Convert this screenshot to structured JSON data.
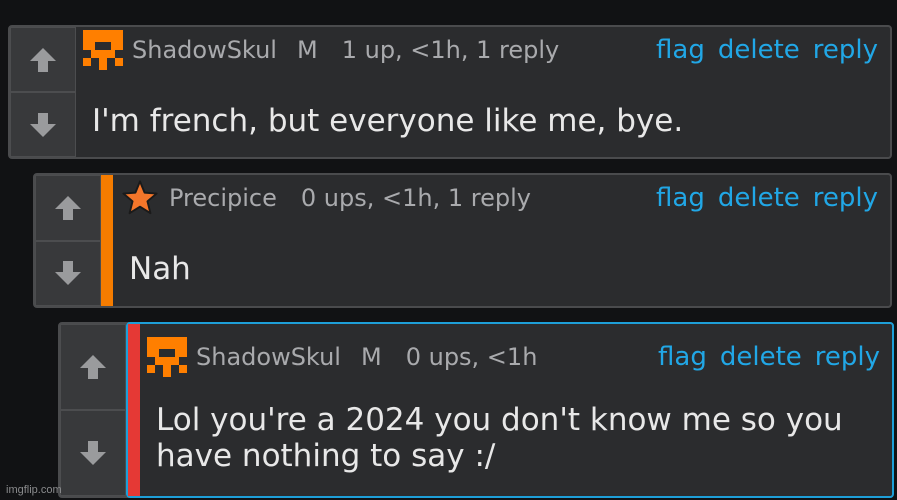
{
  "comments": [
    {
      "username": "ShadowSkul",
      "badge": "M",
      "meta": "1 up, <1h, 1 reply",
      "actions": {
        "flag": "flag",
        "delete": "delete",
        "reply": "reply"
      },
      "text": "I'm french, but everyone like me, bye.",
      "avatar": "orange-pixel-skull-avatar",
      "stripe_color": ""
    },
    {
      "username": "Precipice",
      "badge": "",
      "meta": "0 ups, <1h, 1 reply",
      "actions": {
        "flag": "flag",
        "delete": "delete",
        "reply": "reply"
      },
      "text": "Nah",
      "avatar": "orange-star-icon",
      "stripe_color": "#f57c00"
    },
    {
      "username": "ShadowSkul",
      "badge": "M",
      "meta": "0 ups, <1h",
      "actions": {
        "flag": "flag",
        "delete": "delete",
        "reply": "reply"
      },
      "text": "Lol you're a 2024 you don't know me so you have nothing to say :/",
      "avatar": "orange-pixel-skull-avatar",
      "stripe_color": "#e53935"
    }
  ],
  "colors": {
    "background": "#111214",
    "panel": "#2b2c2e",
    "link": "#21a7e6",
    "selected_border": "#1e9fd8"
  },
  "watermark": "imgflip.com"
}
